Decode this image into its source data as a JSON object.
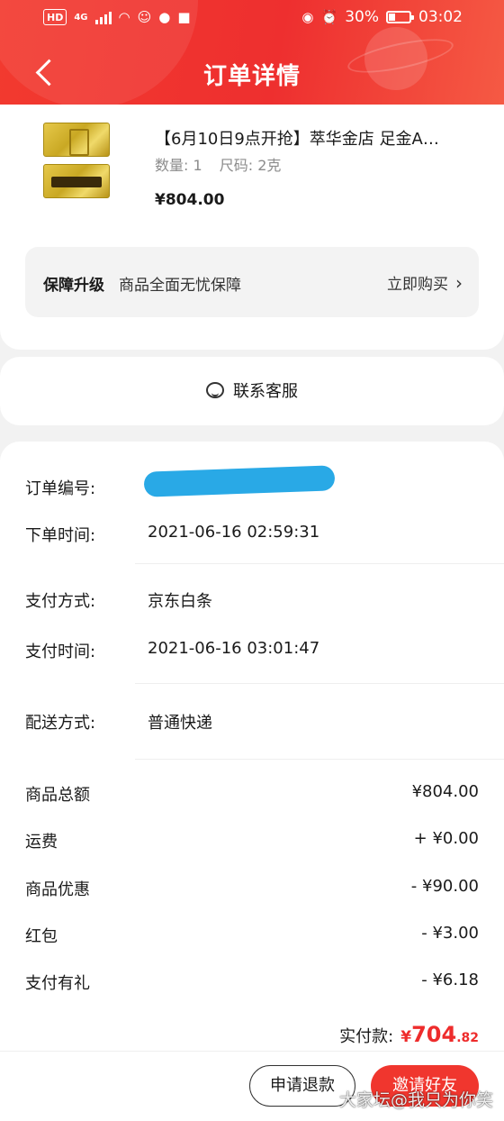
{
  "status_bar": {
    "left_badge": "HD",
    "network": "4G",
    "battery_text": "30%",
    "time": "03:02"
  },
  "nav": {
    "title": "订单详情"
  },
  "product": {
    "title": "【6月10日9点开抢】萃华金店 足金A…",
    "quantity": "数量: 1",
    "size": "尺码: 2克",
    "price": "¥804.00"
  },
  "guarantee": {
    "label": "保障升级",
    "description": "商品全面无忧保障",
    "action": "立即购买"
  },
  "contact": {
    "label": "联系客服"
  },
  "order_info": {
    "order_no_label": "订单编号:",
    "order_time_label": "下单时间:",
    "order_time": "2021-06-16 02:59:31",
    "pay_method_label": "支付方式:",
    "pay_method": "京东白条",
    "pay_time_label": "支付时间:",
    "pay_time": "2021-06-16 03:01:47",
    "delivery_label": "配送方式:",
    "delivery": "普通快递"
  },
  "amounts": [
    {
      "label": "商品总额",
      "value": "¥804.00"
    },
    {
      "label": "运费",
      "value": "+ ¥0.00"
    },
    {
      "label": "商品优惠",
      "value": "- ¥90.00"
    },
    {
      "label": "红包",
      "value": "- ¥3.00"
    },
    {
      "label": "支付有礼",
      "value": "- ¥6.18"
    }
  ],
  "paid": {
    "label": "实付款:",
    "currency": "¥",
    "integer": "704",
    "decimal": ".82"
  },
  "buttons": {
    "refund": "申请退款",
    "invite": "邀请好友"
  },
  "watermark": "大家坛@我只为你笑",
  "colors": {
    "accent": "#f0362e",
    "header": "#ee2f2f",
    "redaction": "#29a9e6"
  }
}
